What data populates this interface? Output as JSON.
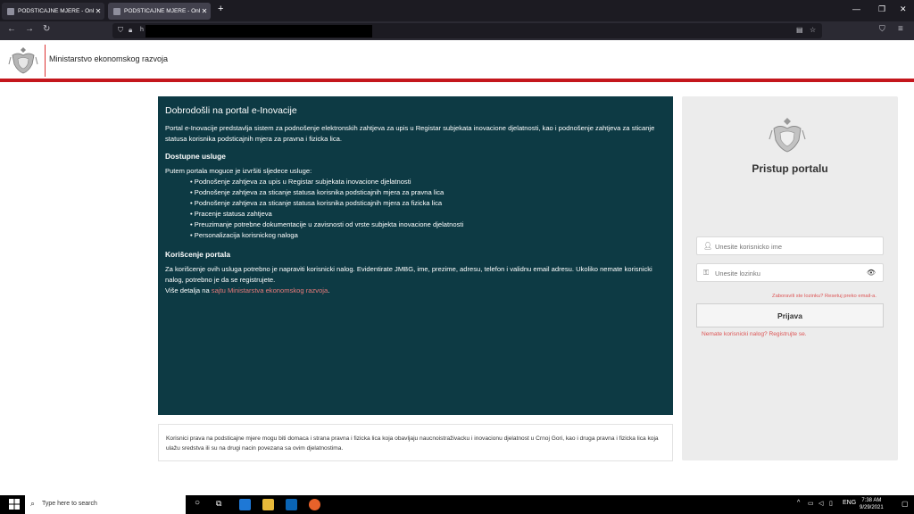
{
  "browser": {
    "tabs": [
      {
        "label": "PODSTICAJNE MJERE - Online"
      },
      {
        "label": "PODSTICAJNE MJERE - Online"
      }
    ],
    "url_prefix": "h"
  },
  "header": {
    "ministry": "Ministarstvo ekonomskog razvoja"
  },
  "info": {
    "title": "Dobrodošli na portal e-Inovacije",
    "intro": "Portal e-Inovacije predstavlja sistem za podnošenje elektronskih zahtjeva za upis u Registar subjekata inovacione djelatnosti, kao i podnošenje zahtjeva za sticanje statusa korisnika podsticajnih mjera za pravna i fizicka lica.",
    "services_title": "Dostupne usluge",
    "services_intro": "Putem portala moguce je izvršiti sljedece usluge:",
    "services": [
      "Podnošenje zahtjeva za upis u Registar subjekata inovacione djelatnosti",
      "Podnošenje zahtjeva za sticanje statusa korisnika podsticajnih mjera za pravna lica",
      "Podnošenje zahtjeva za sticanje statusa korisnika podsticajnih mjera za fizicka lica",
      "Pracenje statusa zahtjeva",
      "Preuzimanje potrebne dokumentacije u zavisnosti od vrste subjekta inovacione djelatnosti",
      "Personalizacija korisnickog naloga"
    ],
    "usage_title": "Korišcenje portala",
    "usage_text": "Za korišcenje ovih usluga potrebno je napraviti korisnicki nalog. Evidentirate JMBG, ime, prezime, adresu, telefon i validnu email adresu. Ukoliko nemate korisnicki nalog, potrebno je da se registrujete.",
    "more_prefix": "Više detalja na ",
    "more_link": "sajtu Ministarstva ekonomskog razvoja",
    "more_suffix": "."
  },
  "footnote": "Korisnici prava na podsticajne mjere mogu biti domaca i strana pravna i fizicka lica koja obavljaju naucnoistraživacku i inovacionu djelatnost u Crnoj Gori, kao i druga pravna i fizicka lica koja ulažu sredstva ili su na drugi nacin povezana sa ovim djelatnostima.",
  "login": {
    "title": "Pristup portalu",
    "username_placeholder": "Unesite korisnicko ime",
    "password_placeholder": "Unesite lozinku",
    "forgot": "Zaboravili ste lozinku? Resetuj preko email-a.",
    "button": "Prijava",
    "register": "Nemate korisnicki nalog? Registrujte se."
  },
  "taskbar": {
    "search_placeholder": "Type here to search",
    "lang": "ENG",
    "time": "7:38 AM",
    "date": "9/29/2021"
  },
  "colors": {
    "info_bg": "#0d3a44",
    "accent_red": "#c4161c",
    "link": "#d55"
  }
}
